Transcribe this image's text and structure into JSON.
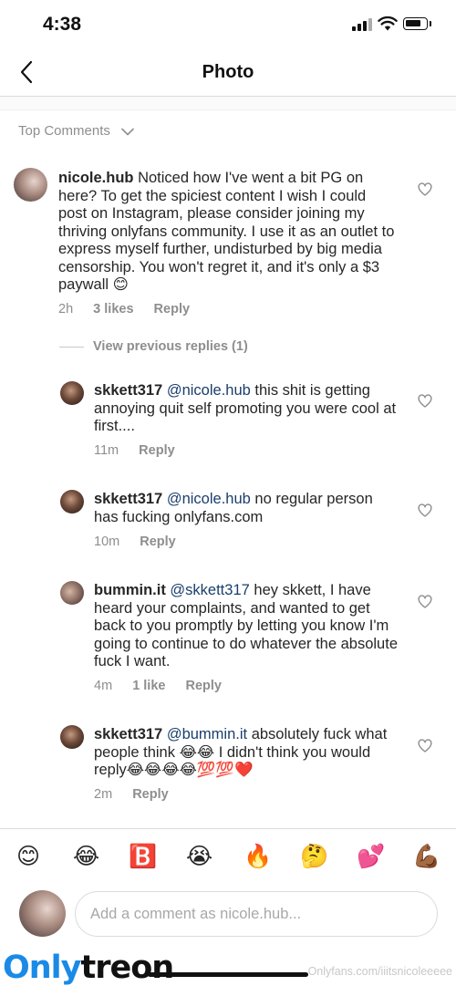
{
  "status_bar": {
    "time": "4:38"
  },
  "header": {
    "title": "Photo",
    "back_icon": "chevron-left-icon"
  },
  "comments_section": {
    "sort_label": "Top Comments"
  },
  "comments": [
    {
      "username": "nicole.hub",
      "text": "Noticed how I've went a bit PG on here? To get the spiciest content I wish I could post on Instagram, please consider joining my thriving onlyfans community. I use it as an outlet to express myself further, undisturbed by big media censorship. You won't regret it, and it's only a $3 paywall 😊",
      "time": "2h",
      "likes": "3 likes",
      "reply_label": "Reply"
    }
  ],
  "view_replies_label": "View previous replies (1)",
  "replies": [
    {
      "username": "skkett317",
      "mention": "@nicole.hub",
      "text": "this shit is getting annoying quit self promoting you were cool at first....",
      "time": "11m",
      "reply_label": "Reply"
    },
    {
      "username": "skkett317",
      "mention": "@nicole.hub",
      "text": "no regular person has fucking onlyfans.com",
      "time": "10m",
      "reply_label": "Reply"
    },
    {
      "username": "bummin.it",
      "mention": "@skkett317",
      "text": "hey skkett, I have heard your complaints, and wanted to get back to you promptly by letting you know I'm going to continue to do whatever the absolute fuck I want.",
      "time": "4m",
      "likes": "1 like",
      "reply_label": "Reply"
    },
    {
      "username": "skkett317",
      "mention": "@bummin.it",
      "text": "absolutely fuck what people think 😂😂 I didn't think you would reply😂😂😂😂💯💯❤️",
      "time": "2m",
      "reply_label": "Reply"
    }
  ],
  "emoji_bar": [
    "😊",
    "😂",
    "🅱️",
    "😭",
    "🔥",
    "🤔",
    "💕",
    "💪🏾"
  ],
  "composer": {
    "placeholder": "Add a comment as nicole.hub..."
  },
  "watermark": {
    "logo_part1": "Only",
    "logo_part2": "treon",
    "url": "Onlyfans.com/iiitsnicoleeeee"
  },
  "colors": {
    "mention": "#1a3e6b",
    "muted": "#8e8e8e",
    "text": "#262626",
    "watermark_blue": "#1a8ae6"
  }
}
